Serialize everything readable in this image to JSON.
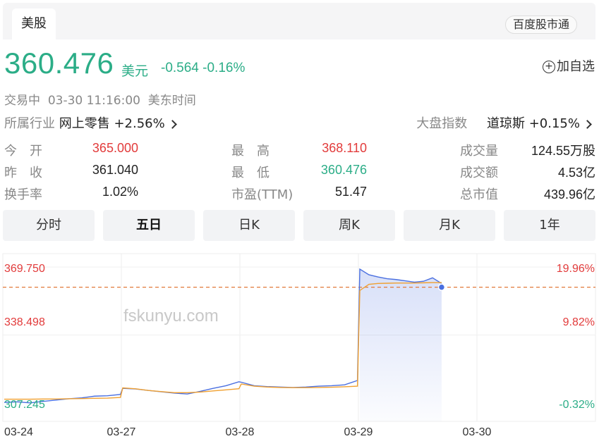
{
  "header": {
    "tab": "美股",
    "badge": "百度股市通"
  },
  "quote": {
    "price": "360.476",
    "currency": "美元",
    "change": "-0.564",
    "change_pct": "-0.16%",
    "add_watch": "加自选",
    "status": "交易中",
    "time": "03-30 11:16:00",
    "timezone": "美东时间",
    "industry_label": "所属行业",
    "industry_value": "网上零售 +2.56%",
    "index_label": "大盘指数",
    "index_value": "道琼斯 +0.15%"
  },
  "stats": {
    "open_label": "今　开",
    "open": "365.000",
    "prev_close_label": "昨　收",
    "prev_close": "361.040",
    "turnover_label": "换手率",
    "turnover": "1.02%",
    "high_label": "最　高",
    "high": "368.110",
    "low_label": "最　低",
    "low": "360.476",
    "pe_label": "市盈(TTM)",
    "pe": "51.47",
    "volume_label": "成交量",
    "volume": "124.55万股",
    "amount_label": "成交额",
    "amount": "4.53亿",
    "mktcap_label": "总市值",
    "mktcap": "439.96亿"
  },
  "tabs": [
    "分时",
    "五日",
    "日K",
    "周K",
    "月K",
    "1年"
  ],
  "active_tab": "五日",
  "watermark": "fskunyu.com",
  "colors": {
    "up": "#e23b3b",
    "down": "#2bad87",
    "price_line": "#4a6fe0",
    "avg_line": "#f0a030",
    "ref_line": "#e27a3b"
  },
  "chart_data": {
    "type": "line",
    "x_labels": [
      "03-24",
      "03-27",
      "03-28",
      "03-29",
      "03-30"
    ],
    "y_left_labels": [
      "369.750",
      "338.498",
      "307.245"
    ],
    "y_right_labels": [
      "19.96%",
      "9.82%",
      "-0.32%"
    ],
    "ylim": [
      307.245,
      369.75
    ],
    "reference_value": 360.476,
    "series": [
      {
        "values": [
          307.5,
          307.8,
          307.3,
          308.0,
          308.6,
          309.2,
          309.6,
          310.4,
          310.6,
          311.2,
          314.0,
          313.7,
          313.0,
          312.4,
          311.8,
          311.4,
          312.6,
          314.0,
          315.2,
          317.0,
          316.8,
          315.2,
          314.8,
          314.6,
          314.4,
          314.6,
          315.0,
          315.2,
          315.6,
          317.6,
          368.8,
          366.2,
          365.2,
          364.4,
          364.0,
          363.4,
          362.8,
          363.2,
          364.8,
          362.2
        ]
      },
      {
        "values": [
          309.0,
          309.0,
          309.0,
          309.1,
          309.1,
          309.2,
          309.3,
          309.4,
          309.5,
          309.8,
          314.2,
          313.8,
          313.0,
          312.5,
          312.0,
          312.0,
          312.3,
          312.8,
          313.3,
          313.8,
          316.0,
          315.0,
          314.6,
          314.4,
          314.3,
          314.3,
          314.4,
          314.5,
          314.7,
          315.0,
          359.0,
          361.8,
          362.2,
          362.3,
          362.4,
          362.4,
          362.4,
          362.5,
          362.6,
          362.6
        ]
      }
    ]
  }
}
